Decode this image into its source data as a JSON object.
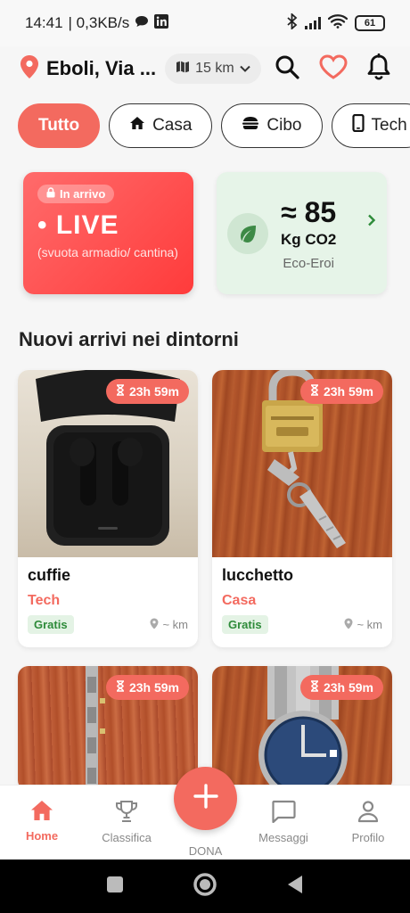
{
  "status_bar": {
    "time": "14:41",
    "network_speed": "| 0,3KB/s",
    "battery": "61"
  },
  "header": {
    "location": "Eboli, Via ...",
    "radius": "15 km",
    "icons": [
      "location-pin-icon",
      "map-icon",
      "chevron-down-icon",
      "search-icon",
      "heart-icon",
      "bell-icon"
    ]
  },
  "categories": [
    {
      "label": "Tutto",
      "active": true,
      "icon": ""
    },
    {
      "label": "Casa",
      "active": false,
      "icon": "home-icon"
    },
    {
      "label": "Cibo",
      "active": false,
      "icon": "burger-icon"
    },
    {
      "label": "Tech",
      "active": false,
      "icon": "phone-icon"
    }
  ],
  "live_banner": {
    "badge": "In arrivo",
    "title": "• LIVE",
    "subtitle": "(svuota armadio/ cantina)"
  },
  "eco_banner": {
    "value": "≈ 85",
    "unit": "Kg CO2",
    "label": "Eco-Eroi"
  },
  "section_title": "Nuovi arrivi nei dintorni",
  "items": [
    {
      "title": "cuffie",
      "category": "Tech",
      "timer": "23h 59m",
      "price": "Gratis",
      "distance": "~ km"
    },
    {
      "title": "lucchetto",
      "category": "Casa",
      "timer": "23h 59m",
      "price": "Gratis",
      "distance": "~ km"
    },
    {
      "title": "",
      "category": "",
      "timer": "23h 59m",
      "price": "",
      "distance": ""
    },
    {
      "title": "",
      "category": "",
      "timer": "23h 59m",
      "price": "",
      "distance": ""
    }
  ],
  "bottom_nav": {
    "home": "Home",
    "classifica": "Classifica",
    "dona": "DONA",
    "messaggi": "Messaggi",
    "profilo": "Profilo"
  },
  "colors": {
    "accent": "#f36a5f",
    "eco_bg": "#e6f4e8",
    "gratis_green": "#2e8b3a"
  }
}
